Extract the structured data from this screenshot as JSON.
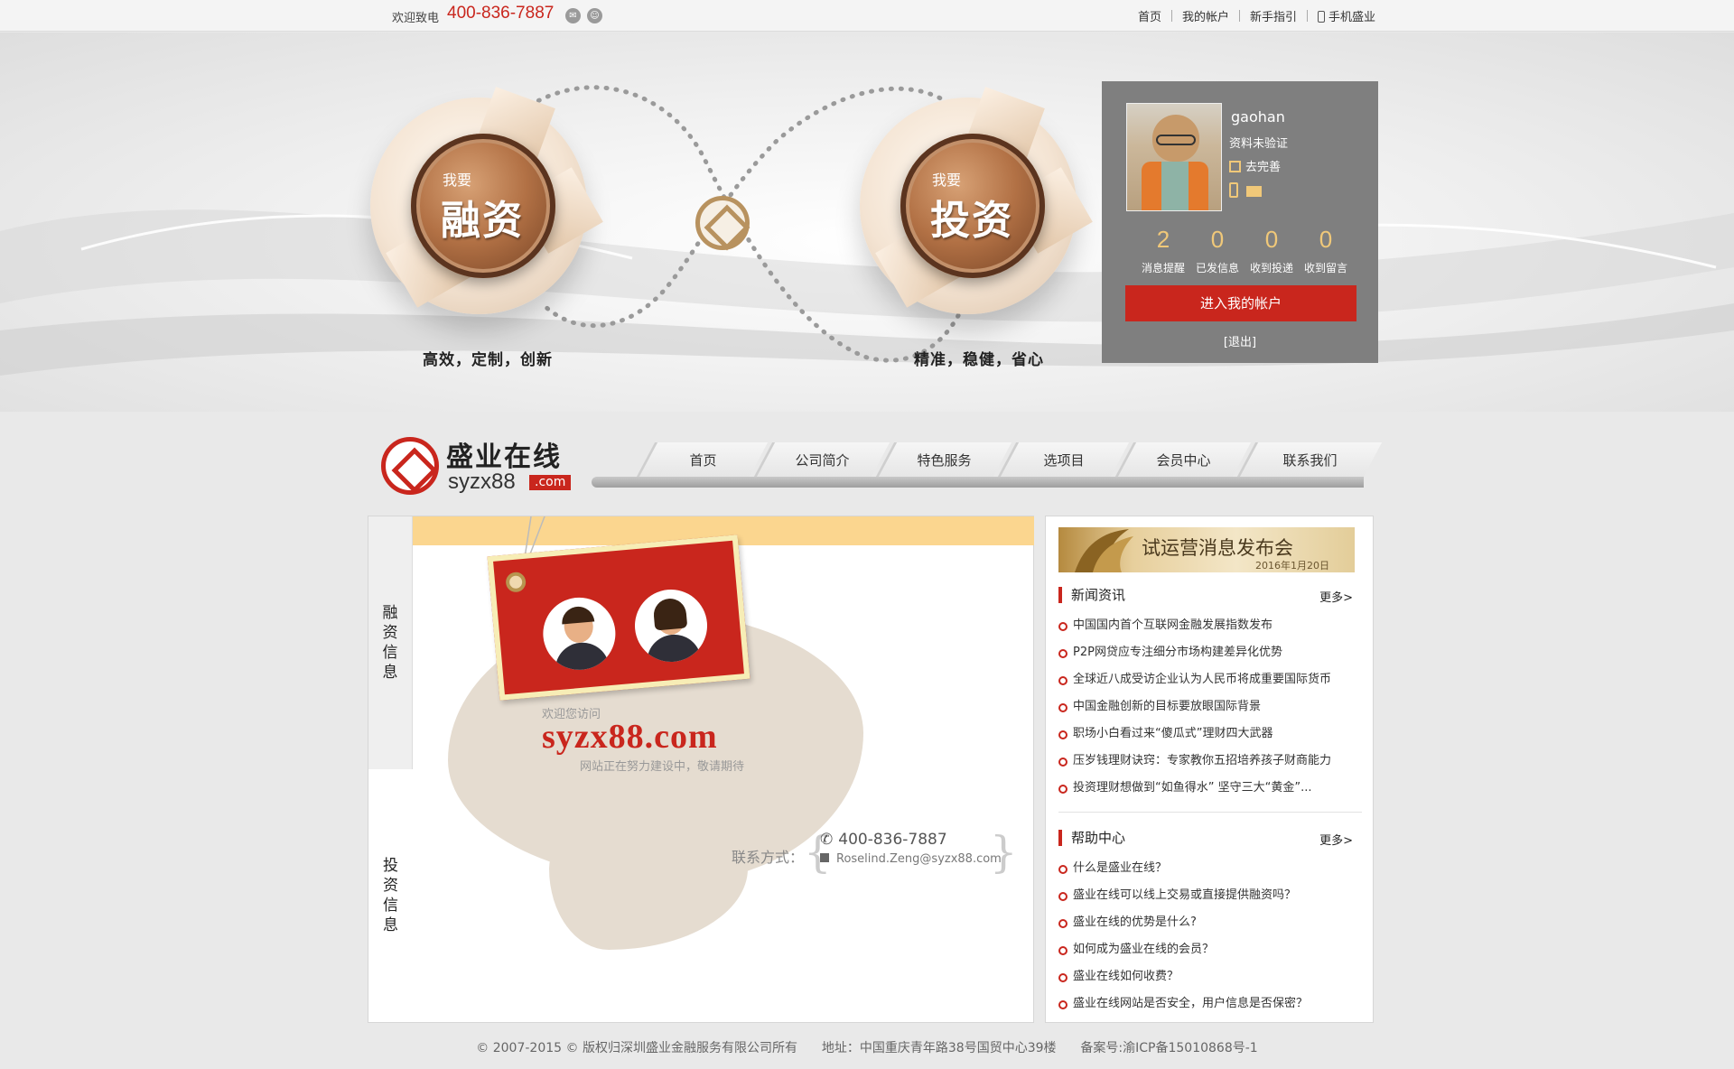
{
  "topbar": {
    "welcome": "欢迎致电",
    "phone": "400-836-7887",
    "wechat_icon": "wechat-icon",
    "qq_icon": "qq-icon",
    "links": [
      "首页",
      "我的帐户",
      "新手指引",
      "手机盛业"
    ]
  },
  "hero": {
    "finance": {
      "small": "我要",
      "big": "融资",
      "tagline": "高效，定制，创新"
    },
    "invest": {
      "small": "我要",
      "big": "投资",
      "tagline": "精准，稳健，省心"
    }
  },
  "user": {
    "name": "gaohan",
    "status": "资料未验证",
    "complete_link": "去完善",
    "stats": [
      {
        "value": "2",
        "label": "消息提醒"
      },
      {
        "value": "0",
        "label": "已发信息"
      },
      {
        "value": "0",
        "label": "收到投递"
      },
      {
        "value": "0",
        "label": "收到留言"
      }
    ],
    "enter_button": "进入我的帐户",
    "logout": "[退出]"
  },
  "brand": {
    "name": "盛业在线",
    "domain": "syzx88",
    "com": ".com"
  },
  "nav": [
    "首页",
    "公司简介",
    "特色服务",
    "选项目",
    "会员中心",
    "联系我们"
  ],
  "main": {
    "side_tabs": [
      "融资信息",
      "投资信息"
    ],
    "welcome": "欢迎您访问",
    "site": "syzx88.com",
    "building": "网站正在努力建设中，敬请期待",
    "contact_label": "联系方式：",
    "contact_phone": "400-836-7887",
    "contact_email": "Roselind.Zeng@syzx88.com"
  },
  "sidebar": {
    "banner_title": "试运营消息发布会",
    "banner_date": "2016年1月20日",
    "news_title": "新闻资讯",
    "news_more": "更多>",
    "news": [
      "中国国内首个互联网金融发展指数发布",
      "P2P网贷应专注细分市场构建差异化优势",
      "全球近八成受访企业认为人民币将成重要国际货币",
      "中国金融创新的目标要放眼国际背景",
      "职场小白看过来“傻瓜式”理财四大武器",
      "压岁钱理财诀窍：专家教你五招培养孩子财商能力",
      "投资理财想做到“如鱼得水” 坚守三大“黄金”..."
    ],
    "help_title": "帮助中心",
    "help_more": "更多>",
    "help": [
      "什么是盛业在线？",
      "盛业在线可以线上交易或直接提供融资吗？",
      "盛业在线的优势是什么?",
      "如何成为盛业在线的会员？",
      "盛业在线如何收费？",
      "盛业在线网站是否安全，用户信息是否保密？"
    ]
  },
  "footer": {
    "copyright": "© 2007-2015 © 版权归深圳盛业金融服务有限公司所有",
    "address": "地址：中国重庆青年路38号国贸中心39楼",
    "icp": "备案号:渝ICP备15010868号-1"
  }
}
